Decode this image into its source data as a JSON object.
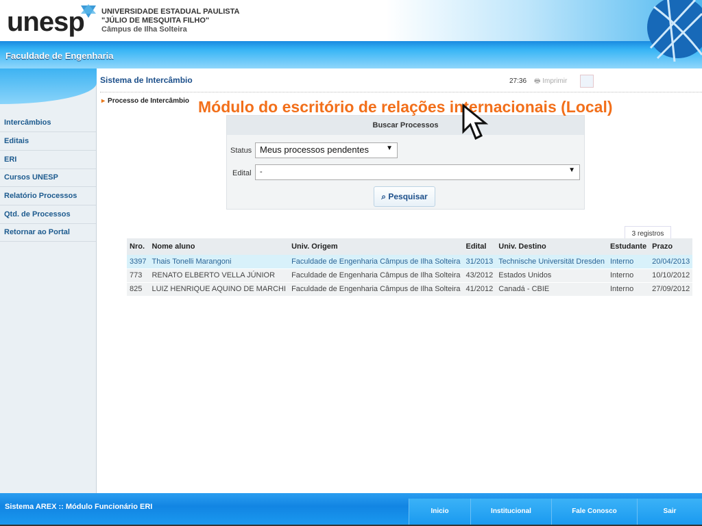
{
  "header": {
    "logo": "unesp",
    "university": "UNIVERSIDADE ESTADUAL PAULISTA",
    "subtitle": "\"JÚLIO DE MESQUITA FILHO\"",
    "campus": "Câmpus de Ilha Solteira"
  },
  "band_title": "Faculdade de Engenharia",
  "sidebar": {
    "items": [
      {
        "label": "Intercâmbios"
      },
      {
        "label": "Editais"
      },
      {
        "label": "ERI"
      },
      {
        "label": "Cursos UNESP"
      },
      {
        "label": "Relatório Processos"
      },
      {
        "label": "Qtd. de Processos"
      },
      {
        "label": "Retornar ao Portal"
      }
    ]
  },
  "main": {
    "title": "Sistema de Intercâmbio",
    "timer": "27:36",
    "print_label": "Imprimir",
    "breadcrumb": "Processo de Intercâmbio",
    "overlay_text": "Módulo do escritório de relações internacionais (Local)"
  },
  "search": {
    "title": "Buscar Processos",
    "status_label": "Status",
    "status_value": "Meus processos pendentes",
    "edital_label": "Edital",
    "edital_value": "-",
    "button": "Pesquisar"
  },
  "results": {
    "count": "3 registros",
    "columns": [
      "Nro.",
      "Nome aluno",
      "Univ. Origem",
      "Edital",
      "Univ. Destino",
      "Estudante",
      "Prazo"
    ],
    "rows": [
      [
        "3397",
        "Thais Tonelli Marangoni",
        "Faculdade de Engenharia Câmpus de Ilha Solteira",
        "31/2013",
        "Technische Universität Dresden",
        "Interno",
        "20/04/2013"
      ],
      [
        "773",
        "RENATO ELBERTO VELLA JÚNIOR",
        "Faculdade de Engenharia Câmpus de Ilha Solteira",
        "43/2012",
        "Estados Unidos",
        "Interno",
        "10/10/2012"
      ],
      [
        "825",
        "LUIZ HENRIQUE AQUINO DE MARCHI",
        "Faculdade de Engenharia Câmpus de Ilha Solteira",
        "41/2012",
        "Canadá - CBIE",
        "Interno",
        "27/09/2012"
      ]
    ]
  },
  "footer": {
    "title": "Sistema AREX :: Módulo Funcionário ERI",
    "nav": [
      "Inicio",
      "Institucional",
      "Fale Conosco",
      "Sair"
    ]
  },
  "colors": {
    "accent": "#f26f1a",
    "brand_blue": "#1a8ae0",
    "link": "#1c5a8e"
  }
}
